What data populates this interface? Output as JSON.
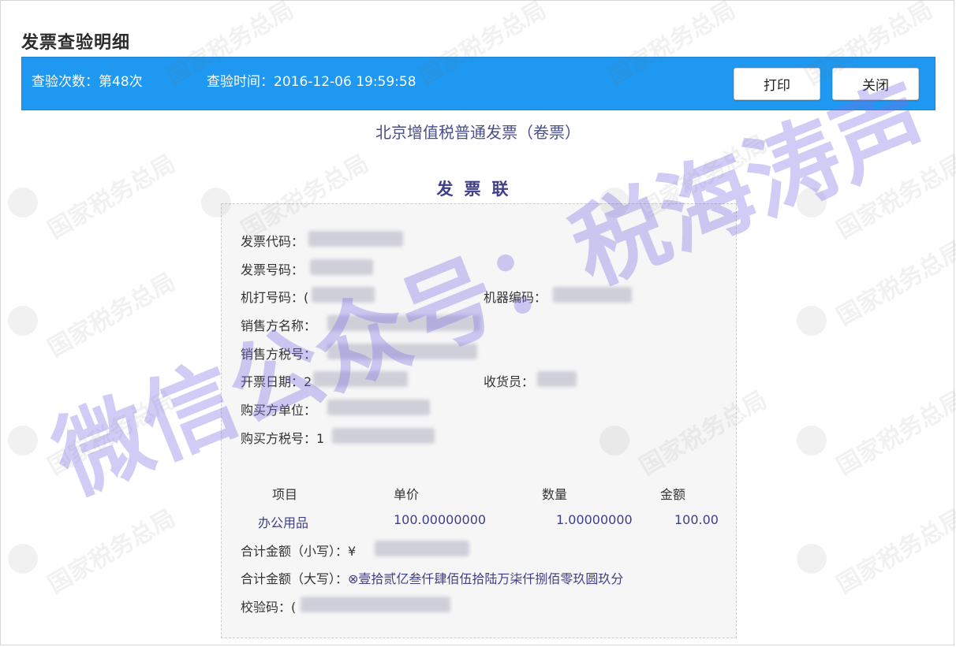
{
  "page": {
    "title": "发票查验明细"
  },
  "info_bar": {
    "check_count": "查验次数：第48次",
    "check_time": "查验时间：2016-12-06 19:59:58",
    "print_label": "打印",
    "close_label": "关闭"
  },
  "invoice": {
    "type_title": "北京增值税普通发票（卷票）",
    "copy_name": "发票联",
    "fields": {
      "invoice_code_label": "发票代码：",
      "invoice_number_label": "发票号码：",
      "machine_print_no_label": "机打号码：(",
      "machine_code_label": "机器编码：",
      "seller_name_label": "销售方名称：",
      "seller_tax_label": "销售方税号：",
      "issue_date_label": "开票日期：2",
      "cashier_label": "收货员：",
      "buyer_unit_label": "购买方单位：",
      "buyer_tax_label": "购买方税号：1"
    },
    "items_table": {
      "headers": [
        "项目",
        "单价",
        "数量",
        "金额"
      ],
      "rows": [
        {
          "item": "办公用品",
          "unit_price": "100.00000000",
          "quantity": "1.00000000",
          "amount": "100.00"
        }
      ]
    },
    "total_small_label": "合计金额（小写）：¥",
    "total_big_label": "合计金额（大写）：",
    "total_big_value": "⊗壹拾贰亿叁仟肆佰伍拾陆万柒仟捌佰零玖圆玖分",
    "check_code_label": "校验码：("
  },
  "watermarks": {
    "light_text": "国家税务总局",
    "overlay_text": "微信公众号：税海涛声",
    "overlay_color": "#7a6ee6"
  }
}
